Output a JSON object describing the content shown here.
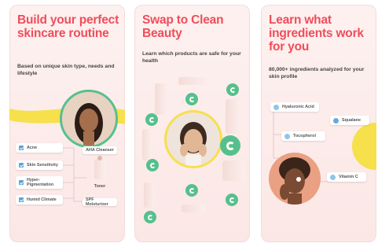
{
  "screens": [
    {
      "title": "Build your perfect skincare routine",
      "subtitle": "Based on unique skin type, needs and lifestyle",
      "concerns": [
        "Acne",
        "Skin Sensitivity",
        "Hyper-Pigmentation",
        "Humid Climate"
      ],
      "products": [
        "AHA Cleanser",
        "Toner",
        "SPF Moisturizer"
      ]
    },
    {
      "title": "Swap to Clean Beauty",
      "subtitle": "Learn which products are safe for your health"
    },
    {
      "title": "Learn what ingredients work for you",
      "subtitle": "80,000+ ingredients analyzed for your skin profile",
      "ingredients": [
        "Hyaluronic Acid",
        "Squalane",
        "Tocopherol",
        "Vitamin C"
      ]
    }
  ],
  "colors": {
    "accent": "#ef4d5a",
    "yellow": "#f6e04c",
    "green": "#56c08d",
    "blue": "#8fc5ea"
  }
}
